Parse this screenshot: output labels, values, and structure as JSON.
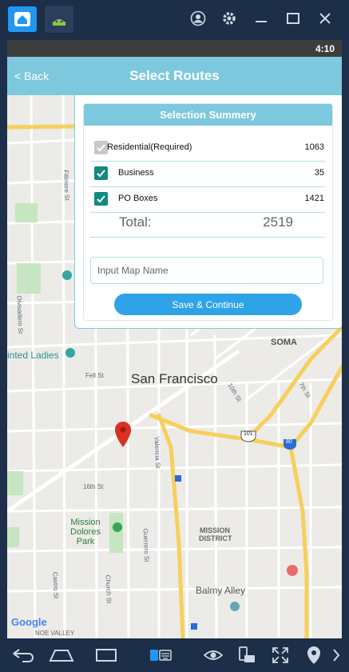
{
  "emulator": {
    "controls": [
      "account-icon",
      "settings-icon",
      "minimize-icon",
      "maximize-icon",
      "close-icon"
    ],
    "bottom_icons": [
      "back-arrow-icon",
      "home-icon",
      "recent-apps-icon",
      "keyboard-icon",
      "eye-icon",
      "rotate-icon",
      "fullscreen-icon",
      "location-pin-icon",
      "more-icon"
    ]
  },
  "statusbar": {
    "time": "4:10"
  },
  "appbar": {
    "back_label": "< Back",
    "title": "Select Routes"
  },
  "summary": {
    "heading": "Selection Summery",
    "rows": [
      {
        "label": "Residential(Required)",
        "value": "1063",
        "checked": true,
        "disabled": true
      },
      {
        "label": "Business",
        "value": "35",
        "checked": true,
        "disabled": false
      },
      {
        "label": "PO Boxes",
        "value": "1421",
        "checked": true,
        "disabled": false
      }
    ],
    "total_label": "Total:",
    "total_value": "2519",
    "map_name_placeholder": "Input Map Name",
    "map_name_value": "",
    "save_label": "Save & Continue"
  },
  "map": {
    "city": "San Francisco",
    "labels": {
      "soma": "SOMA",
      "united_ladies": "inted Ladies",
      "mission_dolores": "Mission Dolores Park",
      "mission_district": "MISSION DISTRICT",
      "balmy_alley": "Balmy Alley",
      "google": "Google",
      "noe_valley": "NOE VALLEY",
      "fillmore": "Fillmore St",
      "divisadero": "Divisadero St",
      "fell": "Fell St",
      "sixteenth": "16th St",
      "valencia": "Valencia St",
      "guerrero": "Guerrero St",
      "castro": "Castro St",
      "church": "Church St",
      "tenth": "10th St",
      "seventh": "7th St",
      "hwy101": "101",
      "hwy80": "80"
    },
    "road_color": "#f7cf5c",
    "pin_color": "#d93025"
  }
}
